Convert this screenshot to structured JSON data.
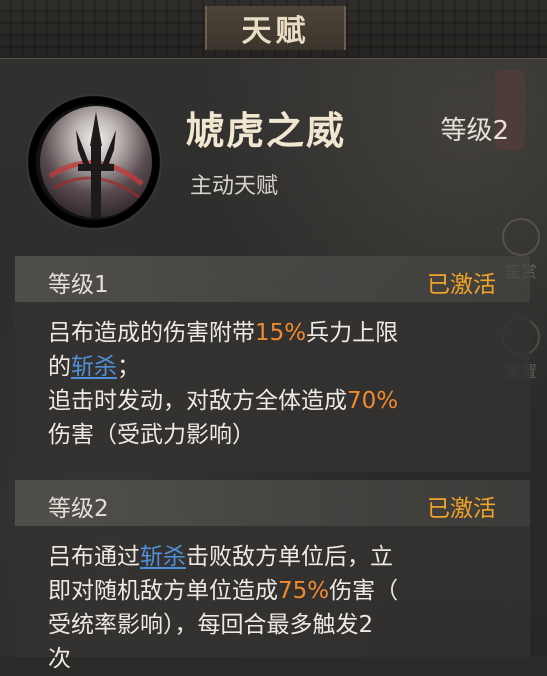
{
  "window": {
    "title": "天赋"
  },
  "skill": {
    "name": "虓虎之威",
    "level": "等级2",
    "type": "主动天赋"
  },
  "side_buttons": [
    "鉴赏",
    "重置"
  ],
  "levels": [
    {
      "title": "等级1",
      "status": "已激活",
      "lines": [
        [
          "吕布造成的伤害附带",
          "15%",
          "兵力上限"
        ],
        [
          "的",
          "斩杀",
          "；"
        ],
        [
          "追击时发动，对敌方全体造成",
          "70%",
          ""
        ],
        [
          "伤害（受武力影响）"
        ]
      ]
    },
    {
      "title": "等级2",
      "status": "已激活",
      "lines": [
        [
          "吕布通过",
          "斩杀",
          "击败敌方单位后，立"
        ],
        [
          "即对随机敌方单位造成",
          "75%",
          "伤害（"
        ],
        [
          "受统率影响），每回合最多触发2"
        ],
        [
          "次"
        ]
      ]
    }
  ],
  "colors": {
    "status": "#f0a427",
    "highlight": "#f08a2c",
    "keyword": "#4f8fd9"
  }
}
